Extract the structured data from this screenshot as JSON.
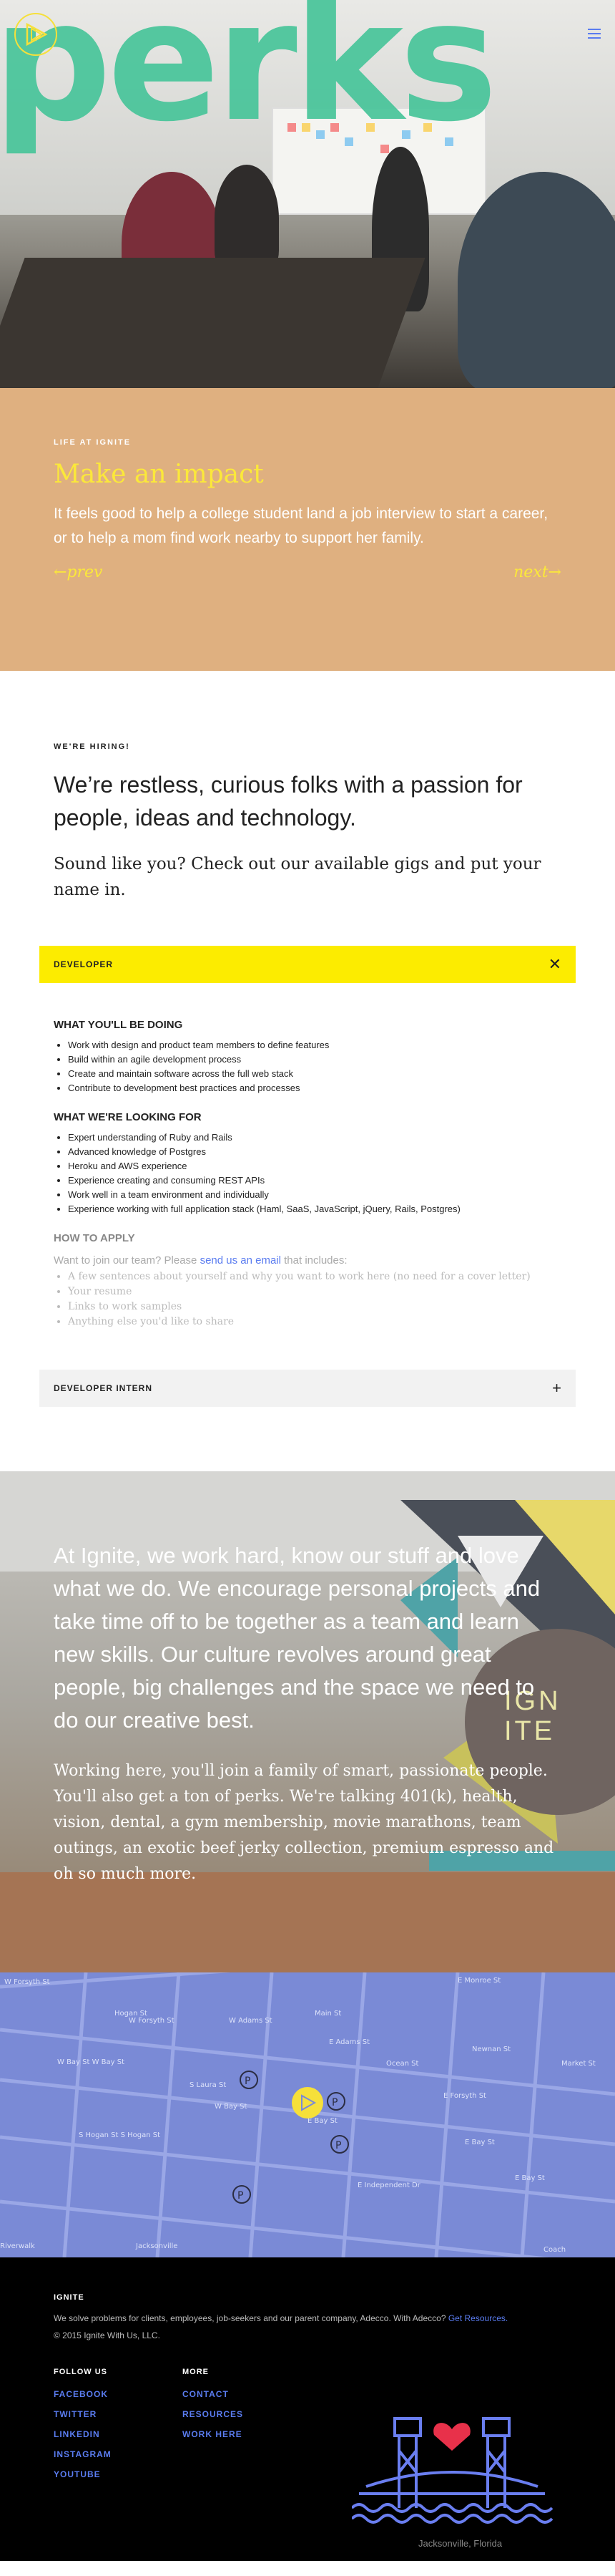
{
  "hero": {
    "word": "perks"
  },
  "impact": {
    "eyebrow": "LIFE AT IGNITE",
    "title": "Make an impact",
    "body": "It feels good to help a college student land a job interview to start a career, or to help a mom find work nearby to support her family.",
    "prev": "←prev",
    "next": "next→"
  },
  "hiring": {
    "eyebrow": "WE'RE HIRING!",
    "headline": "We’re restless, curious folks with a passion for people, ideas and technology.",
    "sub": "Sound like you? Check out our available gigs and put your name in.",
    "jobs": [
      {
        "title": "DEVELOPER",
        "toggle": "✕",
        "doing_heading": "WHAT YOU'LL BE DOING",
        "doing": [
          "Work with design and product team members to define features",
          "Build within an agile development process",
          "Create and maintain software across the full web stack",
          "Contribute to development best practices and processes"
        ],
        "looking_heading": "WHAT WE'RE LOOKING FOR",
        "looking": [
          "Expert understanding of Ruby and Rails",
          "Advanced knowledge of Postgres",
          "Heroku and AWS experience",
          "Experience creating and consuming REST APIs",
          "Work well in a team environment and individually",
          "Experience working with full application stack (Haml, SaaS, JavaScript, jQuery, Rails, Postgres)"
        ],
        "apply_heading": "HOW TO APPLY",
        "apply_pre": "Want to join our team? Please ",
        "apply_link": "send us an email",
        "apply_post": " that includes:",
        "apply_items": [
          "A few sentences about yourself and why you want to work here (no need for a cover letter)",
          "Your resume",
          "Links to work samples",
          "Anything else you'd like to share"
        ]
      },
      {
        "title": "DEVELOPER INTERN",
        "toggle": "+"
      }
    ]
  },
  "culture": {
    "p1": "At Ignite, we work hard, know our stuff and love what we do. We encourage personal projects and take time off to be together as a team and learn new skills. Our culture revolves around great people, big challenges and the space we need to do our creative best.",
    "p2": "Working here, you'll join a family of smart, passionate people. You'll also get a ton of perks. We're talking 401(k), health, vision, dental, a gym membership, movie marathons, team outings, an exotic beef jerky collection, premium espresso and oh so much more.",
    "wall_text": "IGNITE"
  },
  "map": {
    "streets": [
      "E Monroe St",
      "W Forsyth St",
      "W Adams St",
      "E Adams St",
      "W Bay St",
      "E Bay St",
      "E Forsyth St",
      "E Independent Dr",
      "Riverwalk",
      "W Bay St W Bay St",
      "Hogan St",
      "S Laura St",
      "Main St",
      "Ocean St",
      "Newnan St",
      "Market St",
      "S Hogan St S Hogan St",
      "Jacksonville",
      "Coach"
    ],
    "parking": "P"
  },
  "footer": {
    "brand": "IGNITE",
    "blurb_pre": "We solve problems for clients, employees, job-seekers and our parent company, Adecco. With Adecco? ",
    "blurb_link": "Get Resources.",
    "copyright": "© 2015 Ignite With Us, LLC.",
    "follow_heading": "FOLLOW US",
    "follow": [
      "FACEBOOK",
      "TWITTER",
      "LINKEDIN",
      "INSTAGRAM",
      "YOUTUBE"
    ],
    "more_heading": "MORE",
    "more": [
      "CONTACT",
      "RESOURCES",
      "WORK HERE"
    ],
    "city": "Jacksonville, Florida"
  },
  "colors": {
    "accent_yellow": "#fbe83a",
    "accent_green": "#48c59a",
    "link_blue": "#5a7cf0",
    "impact_bg": "#dfb080",
    "map_bg": "#7a8ad6"
  }
}
